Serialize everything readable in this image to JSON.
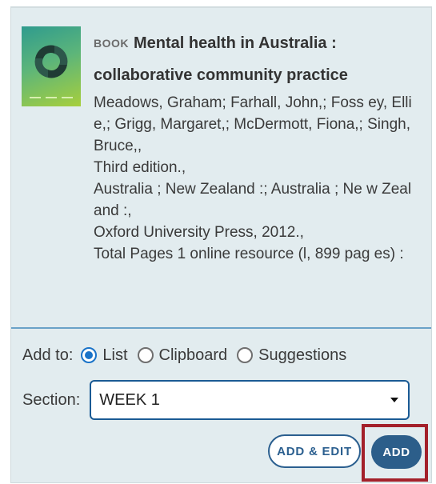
{
  "record": {
    "type_label": "BOOK",
    "title": "Mental health in Australia : collaborative community practice",
    "authors": "Meadows, Graham; Farhall, John,; Foss ey, Ellie,; Grigg, Margaret,; McDermott, Fiona,; Singh, Bruce,,",
    "edition": "Third edition.,",
    "place": "Australia ; New Zealand :; Australia ; Ne w Zealand :,",
    "publisher": "Oxford University Press, 2012.,",
    "pages": "Total Pages 1 online resource (l, 899 pag es) :"
  },
  "add_to": {
    "label": "Add to:",
    "options": [
      {
        "label": "List",
        "checked": true
      },
      {
        "label": "Clipboard",
        "checked": false
      },
      {
        "label": "Suggestions",
        "checked": false
      }
    ]
  },
  "section": {
    "label": "Section:",
    "selected": "WEEK 1"
  },
  "buttons": {
    "add_edit": "ADD & EDIT",
    "add": "ADD"
  },
  "colors": {
    "card_bg": "#e2ecef",
    "accent": "#2c5e8a",
    "highlight": "#a3202a",
    "radio_checked": "#1a73c8"
  }
}
